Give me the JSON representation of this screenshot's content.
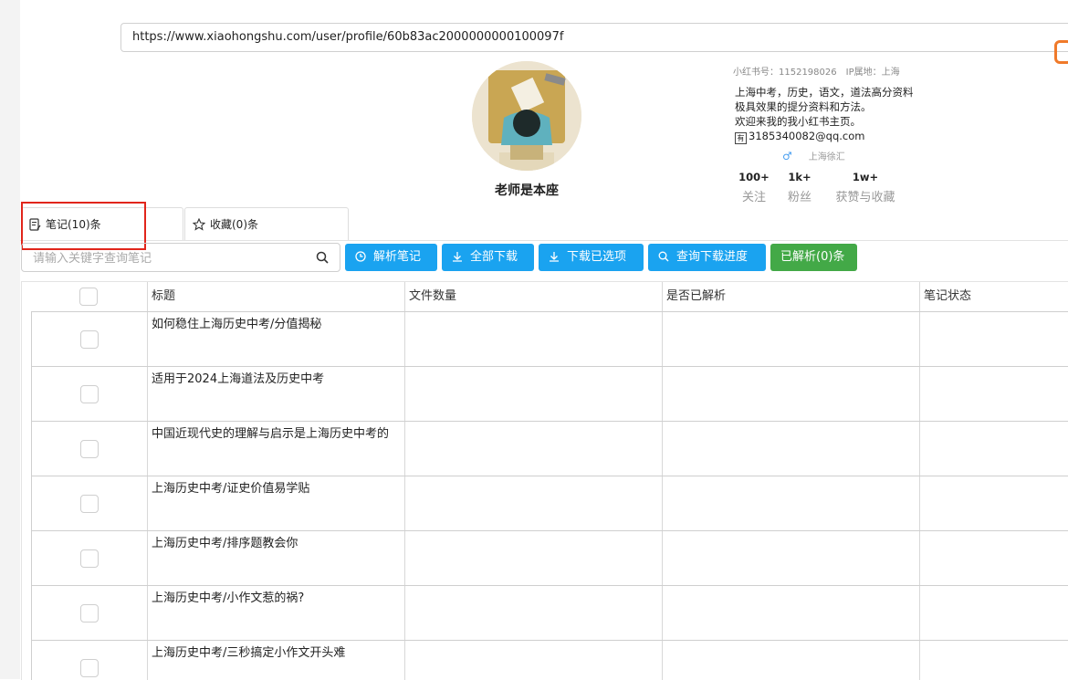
{
  "url": "https://www.xiaohongshu.com/user/profile/60b83ac2000000000100097f",
  "profile": {
    "name": "老师是本座",
    "id_label": "小红书号：1152198026",
    "ip_label": "IP属地：上海",
    "bio": [
      "上海中考，历史，语文，道法高分资料",
      "极具效果的提分资料和方法。",
      "欢迎来我的我小红书主页。",
      "3185340082@qq.com"
    ],
    "mail_badge": "有",
    "gender_icon": "♂",
    "location": "上海徐汇",
    "stats": [
      {
        "num": "100+",
        "label": "关注"
      },
      {
        "num": "1k+",
        "label": "粉丝"
      },
      {
        "num": "1w+",
        "label": "获赞与收藏"
      }
    ]
  },
  "tabs": [
    {
      "label": "笔记(10)条",
      "icon": "note-icon"
    },
    {
      "label": "收藏(0)条",
      "icon": "star-icon"
    }
  ],
  "search": {
    "placeholder": "请输入关键字查询笔记"
  },
  "buttons": {
    "parse": "解析笔记",
    "download_all": "全部下载",
    "download_selected": "下载已选项",
    "query_progress": "查询下载进度",
    "parsed_count": "已解析(0)条"
  },
  "colors": {
    "primary": "#1aa3f0",
    "success": "#43a947",
    "highlight": "#e1251b"
  },
  "table": {
    "headers": [
      "标题",
      "文件数量",
      "是否已解析",
      "笔记状态"
    ],
    "rows": [
      {
        "title": "如何稳住上海历史中考/分值揭秘"
      },
      {
        "title": "适用于2024上海道法及历史中考"
      },
      {
        "title": "中国近现代史的理解与启示是上海历史中考的"
      },
      {
        "title": "上海历史中考/证史价值易学贴"
      },
      {
        "title": "上海历史中考/排序题教会你"
      },
      {
        "title": "上海历史中考/小作文惹的祸?"
      },
      {
        "title": "上海历史中考/三秒搞定小作文开头难"
      }
    ]
  }
}
